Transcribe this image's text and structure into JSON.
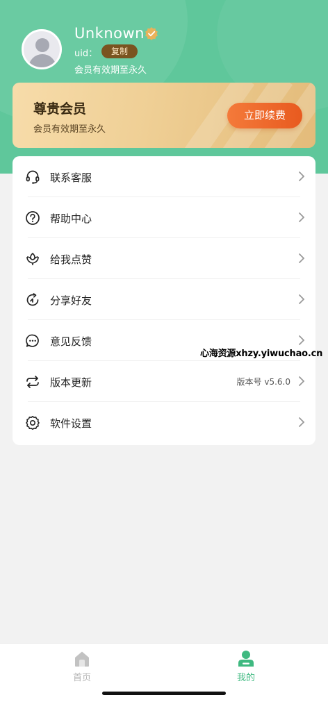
{
  "profile": {
    "username": "Unknown",
    "uid_label": "uid：",
    "copy_label": "复制",
    "member_expiry": "会员有效期至永久"
  },
  "vip_card": {
    "title": "尊贵会员",
    "subtitle": "会员有效期至永久",
    "renew_label": "立即续费"
  },
  "menu": {
    "items": [
      {
        "label": "联系客服",
        "icon": "headset-icon"
      },
      {
        "label": "帮助中心",
        "icon": "help-circle-icon"
      },
      {
        "label": "给我点赞",
        "icon": "flower-icon"
      },
      {
        "label": "分享好友",
        "icon": "share-icon"
      },
      {
        "label": "意见反馈",
        "icon": "chat-bubble-icon"
      },
      {
        "label": "版本更新",
        "icon": "refresh-icon",
        "value": "版本号 v5.6.0"
      },
      {
        "label": "软件设置",
        "icon": "gear-icon"
      }
    ]
  },
  "tabbar": {
    "home_label": "首页",
    "mine_label": "我的"
  },
  "watermark": "心海资源xhzy.yiwuchao.cn",
  "colors": {
    "header_green": "#5fc79b",
    "active_tab": "#3fb980",
    "inactive_tab": "#b3b3b3",
    "renew_orange": "#ee6a2a",
    "vip_gold": "#efcf95"
  }
}
